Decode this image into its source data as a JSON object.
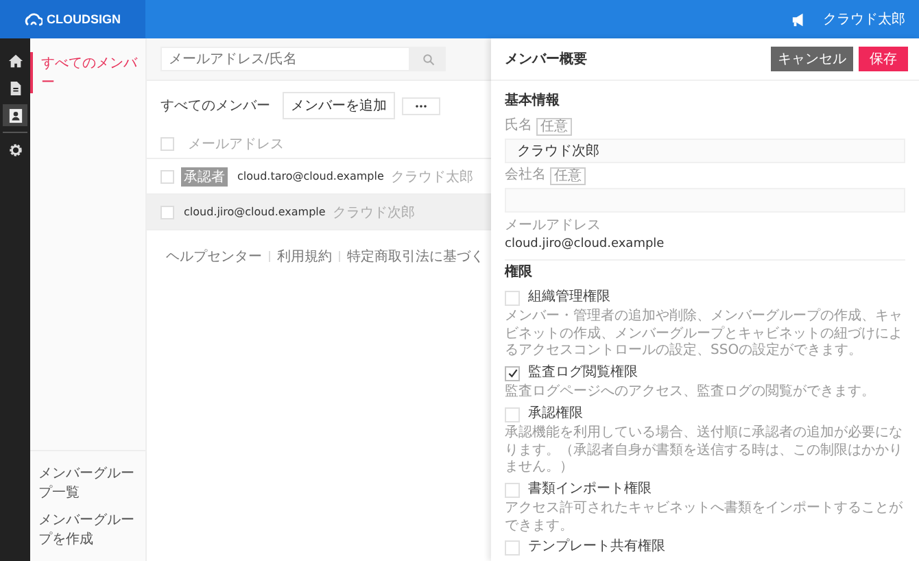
{
  "header": {
    "logo": "CLOUDSIGN",
    "user": "クラウド太郎"
  },
  "nav_icons": [
    {
      "kind": "home",
      "selected": false
    },
    {
      "kind": "document",
      "selected": false
    },
    {
      "kind": "contact",
      "selected": true
    },
    {
      "kind": "gear",
      "selected": false
    }
  ],
  "sidebar": {
    "items": [
      {
        "label": "すべてのメンバー",
        "selected": true
      }
    ],
    "bottom_links": [
      "メンバーグループ一覧",
      "メンバーグループを作成"
    ]
  },
  "main": {
    "search": {
      "placeholder": "メールアドレス/氏名"
    },
    "title": "すべてのメンバー",
    "add_button": "メンバーを追加",
    "table": {
      "select_all_checked": false,
      "column": "メールアドレス",
      "rows": [
        {
          "badge": "承認者",
          "email": "cloud.taro@cloud.example",
          "name": "クラウド太郎",
          "checked": false,
          "selected": false
        },
        {
          "email": "cloud.jiro@cloud.example",
          "name": "クラウド次郎",
          "checked": false,
          "selected": true
        }
      ]
    },
    "footer_links": [
      "ヘルプセンター",
      "利用規約",
      "特定商取引法に基づく"
    ]
  },
  "panel": {
    "title": "メンバー概要",
    "cancel": "キャンセル",
    "save": "保存",
    "basic_heading": "基本情報",
    "fields": [
      {
        "label": "氏名",
        "tag": "任意",
        "value": "クラウド次郎"
      },
      {
        "label": "会社名",
        "tag": "任意"
      }
    ],
    "email_label": "メールアドレス",
    "email": "cloud.jiro@cloud.example",
    "permissions_heading": "権限",
    "permissions": [
      {
        "label": "組織管理権限",
        "checked": false,
        "description": "メンバー・管理者の追加や削除、メンバーグループの作成、キャビネットの作成、メンバーグループとキャビネットの紐づけによるアクセスコントロールの設定、SSOの設定ができます。"
      },
      {
        "label": "監査ログ閲覧権限",
        "checked": true,
        "description": "監査ログページへのアクセス、監査ログの閲覧ができます。"
      },
      {
        "label": "承認権限",
        "checked": false,
        "description": "承認機能を利用している場合、送付順に承認者の追加が必要になります。（承認者自身が書類を送信する時は、この制限はかかりません。）"
      },
      {
        "label": "書類インポート権限",
        "checked": false,
        "description": "アクセス許可されたキャビネットへ書類をインポートすることができます。"
      },
      {
        "label": "テンプレート共有権限",
        "checked": false
      }
    ]
  }
}
